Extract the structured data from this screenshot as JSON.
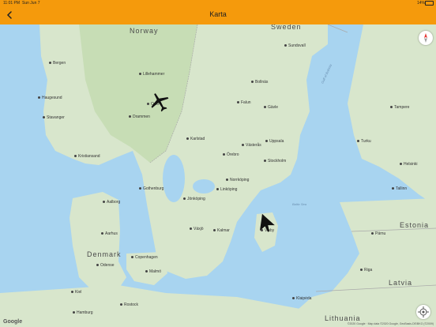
{
  "status": {
    "time": "11:01 PM",
    "date": "Sun Jun 7",
    "battery": "14%"
  },
  "nav": {
    "title": "Karta",
    "back_icon": "chevron-left-icon"
  },
  "map": {
    "countries": [
      "Norway",
      "Sweden",
      "Denmark",
      "Estonia",
      "Latvia",
      "Lithuania"
    ],
    "cities": [
      "Bergen",
      "Oslo",
      "Drammen",
      "Stavanger",
      "Kristiansand",
      "Haugesund",
      "Lillehammer",
      "Falun",
      "Gävle",
      "Bollnäs",
      "Sundsvall",
      "Uppsala",
      "Västerås",
      "Stockholm",
      "Karlstad",
      "Örebro",
      "Norrköping",
      "Linköping",
      "Jönköping",
      "Gothenburg",
      "Växjö",
      "Kalmar",
      "Visby",
      "Malmö",
      "Copenhagen",
      "Aarhus",
      "Aalborg",
      "Odense",
      "Hamburg",
      "Turku",
      "Tampere",
      "Helsinki",
      "Tallinn",
      "Pärnu",
      "Riga",
      "Klaipėda",
      "Kiel",
      "Rostock"
    ],
    "water": [
      "Baltic Sea",
      "Gulf of Bothnia"
    ],
    "google_label": "Google",
    "attribution": "©2020 Google · Map data ©2020 Google, GeoBasis-DE/BKG (©2009)"
  }
}
